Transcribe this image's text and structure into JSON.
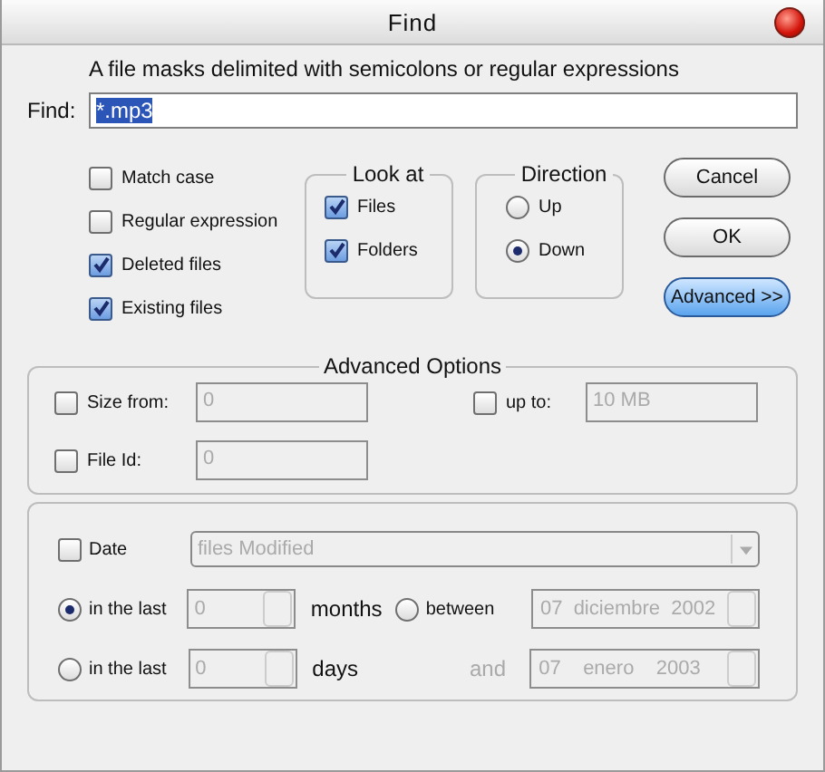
{
  "window": {
    "title": "Find"
  },
  "hint": "A file masks delimited with semicolons or regular expressions",
  "find": {
    "label": "Find:",
    "value": "*.mp3"
  },
  "options": [
    {
      "label": "Match case",
      "checked": false
    },
    {
      "label": "Regular expression",
      "checked": false
    },
    {
      "label": "Deleted files",
      "checked": true
    },
    {
      "label": "Existing files",
      "checked": true
    }
  ],
  "look_at": {
    "title": "Look at",
    "items": [
      {
        "label": "Files",
        "checked": true
      },
      {
        "label": "Folders",
        "checked": true
      }
    ]
  },
  "direction": {
    "title": "Direction",
    "items": [
      {
        "label": "Up",
        "selected": false
      },
      {
        "label": "Down",
        "selected": true
      }
    ]
  },
  "buttons": [
    {
      "label": "Cancel",
      "kind": "normal"
    },
    {
      "label": "OK",
      "kind": "normal"
    },
    {
      "label": "Advanced >>",
      "kind": "highlighted"
    }
  ],
  "advanced": {
    "title": "Advanced Options",
    "size_from": {
      "label": "Size from:",
      "checked": false,
      "value": "0"
    },
    "up_to": {
      "label": "up to:",
      "checked": false,
      "value": "10 MB"
    },
    "file_id": {
      "label": "File Id:",
      "checked": false,
      "value": "0"
    }
  },
  "date": {
    "label": "Date",
    "checked": false,
    "dropdown": "files Modified",
    "last_months": {
      "label": "in the last",
      "selected": true,
      "value": "0",
      "unit": "months"
    },
    "last_days": {
      "label": "in the last",
      "selected": false,
      "value": "0",
      "unit": "days"
    },
    "between": {
      "label": "between",
      "selected": false,
      "from": "07  diciembre  2002",
      "and": "and",
      "to": "07    enero    2003"
    }
  }
}
